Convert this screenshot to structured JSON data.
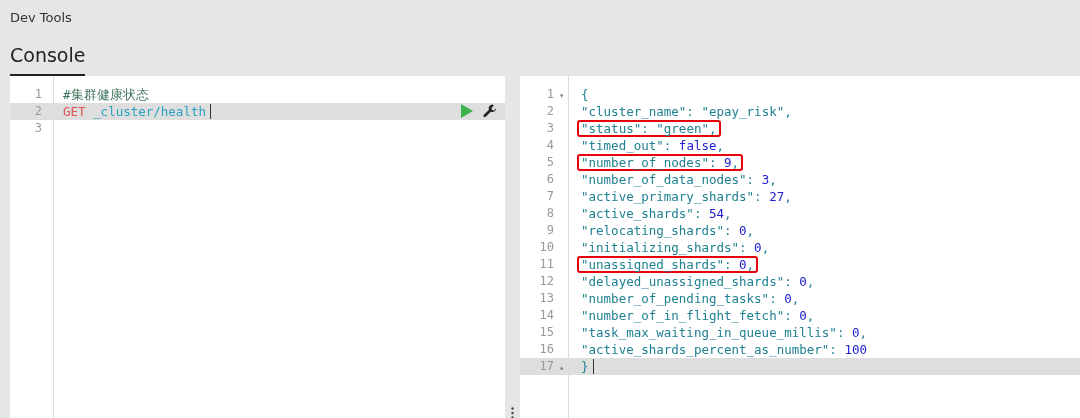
{
  "app_title": "Dev Tools",
  "tabs": [
    {
      "label": "Console",
      "selected": true
    }
  ],
  "request_editor": {
    "lines": [
      {
        "number": "1",
        "active": false,
        "parts": [
          {
            "kind": "comment",
            "text": "#集群健康状态"
          }
        ]
      },
      {
        "number": "2",
        "active": true,
        "parts": [
          {
            "kind": "method",
            "text": "GET"
          },
          {
            "kind": "url",
            "text": "_cluster/health"
          }
        ]
      },
      {
        "number": "3",
        "active": false
      }
    ]
  },
  "response_editor": {
    "lines": [
      {
        "number": "1",
        "fold": "▾",
        "active": false,
        "highlighted": false,
        "parts": [
          {
            "kind": "punct",
            "text": "{"
          }
        ]
      },
      {
        "number": "2",
        "active": false,
        "highlighted": false,
        "parts": [
          {
            "kind": "key",
            "text": "\"cluster_name\""
          },
          {
            "kind": "punct",
            "text": ": "
          },
          {
            "kind": "string",
            "text": "\"epay_risk\""
          },
          {
            "kind": "punct",
            "text": ","
          }
        ]
      },
      {
        "number": "3",
        "active": false,
        "highlighted": true,
        "parts": [
          {
            "kind": "key",
            "text": "\"status\""
          },
          {
            "kind": "punct",
            "text": ": "
          },
          {
            "kind": "string",
            "text": "\"green\""
          },
          {
            "kind": "punct",
            "text": ","
          }
        ]
      },
      {
        "number": "4",
        "active": false,
        "highlighted": false,
        "parts": [
          {
            "kind": "key",
            "text": "\"timed_out\""
          },
          {
            "kind": "punct",
            "text": ": "
          },
          {
            "kind": "boolean",
            "text": "false"
          },
          {
            "kind": "punct",
            "text": ","
          }
        ]
      },
      {
        "number": "5",
        "active": false,
        "highlighted": true,
        "parts": [
          {
            "kind": "key",
            "text": "\"number_of_nodes\""
          },
          {
            "kind": "punct",
            "text": ": "
          },
          {
            "kind": "number",
            "text": "9"
          },
          {
            "kind": "punct",
            "text": ","
          }
        ]
      },
      {
        "number": "6",
        "active": false,
        "highlighted": false,
        "parts": [
          {
            "kind": "key",
            "text": "\"number_of_data_nodes\""
          },
          {
            "kind": "punct",
            "text": ": "
          },
          {
            "kind": "number",
            "text": "3"
          },
          {
            "kind": "punct",
            "text": ","
          }
        ]
      },
      {
        "number": "7",
        "active": false,
        "highlighted": false,
        "parts": [
          {
            "kind": "key",
            "text": "\"active_primary_shards\""
          },
          {
            "kind": "punct",
            "text": ": "
          },
          {
            "kind": "number",
            "text": "27"
          },
          {
            "kind": "punct",
            "text": ","
          }
        ]
      },
      {
        "number": "8",
        "active": false,
        "highlighted": false,
        "parts": [
          {
            "kind": "key",
            "text": "\"active_shards\""
          },
          {
            "kind": "punct",
            "text": ": "
          },
          {
            "kind": "number",
            "text": "54"
          },
          {
            "kind": "punct",
            "text": ","
          }
        ]
      },
      {
        "number": "9",
        "active": false,
        "highlighted": false,
        "parts": [
          {
            "kind": "key",
            "text": "\"relocating_shards\""
          },
          {
            "kind": "punct",
            "text": ": "
          },
          {
            "kind": "number",
            "text": "0"
          },
          {
            "kind": "punct",
            "text": ","
          }
        ]
      },
      {
        "number": "10",
        "active": false,
        "highlighted": false,
        "parts": [
          {
            "kind": "key",
            "text": "\"initializing_shards\""
          },
          {
            "kind": "punct",
            "text": ": "
          },
          {
            "kind": "number",
            "text": "0"
          },
          {
            "kind": "punct",
            "text": ","
          }
        ]
      },
      {
        "number": "11",
        "active": false,
        "highlighted": true,
        "parts": [
          {
            "kind": "key",
            "text": "\"unassigned_shards\""
          },
          {
            "kind": "punct",
            "text": ": "
          },
          {
            "kind": "number",
            "text": "0"
          },
          {
            "kind": "punct",
            "text": ","
          }
        ]
      },
      {
        "number": "12",
        "active": false,
        "highlighted": false,
        "parts": [
          {
            "kind": "key",
            "text": "\"delayed_unassigned_shards\""
          },
          {
            "kind": "punct",
            "text": ": "
          },
          {
            "kind": "number",
            "text": "0"
          },
          {
            "kind": "punct",
            "text": ","
          }
        ]
      },
      {
        "number": "13",
        "active": false,
        "highlighted": false,
        "parts": [
          {
            "kind": "key",
            "text": "\"number_of_pending_tasks\""
          },
          {
            "kind": "punct",
            "text": ": "
          },
          {
            "kind": "number",
            "text": "0"
          },
          {
            "kind": "punct",
            "text": ","
          }
        ]
      },
      {
        "number": "14",
        "active": false,
        "highlighted": false,
        "parts": [
          {
            "kind": "key",
            "text": "\"number_of_in_flight_fetch\""
          },
          {
            "kind": "punct",
            "text": ": "
          },
          {
            "kind": "number",
            "text": "0"
          },
          {
            "kind": "punct",
            "text": ","
          }
        ]
      },
      {
        "number": "15",
        "active": false,
        "highlighted": false,
        "parts": [
          {
            "kind": "key",
            "text": "\"task_max_waiting_in_queue_millis\""
          },
          {
            "kind": "punct",
            "text": ": "
          },
          {
            "kind": "number",
            "text": "0"
          },
          {
            "kind": "punct",
            "text": ","
          }
        ]
      },
      {
        "number": "16",
        "active": false,
        "highlighted": false,
        "parts": [
          {
            "kind": "key",
            "text": "\"active_shards_percent_as_number\""
          },
          {
            "kind": "punct",
            "text": ": "
          },
          {
            "kind": "number",
            "text": "100"
          }
        ]
      },
      {
        "number": "17",
        "fold": "▴",
        "active": true,
        "highlighted": false,
        "parts": [
          {
            "kind": "punct",
            "text": "}"
          }
        ]
      }
    ]
  }
}
